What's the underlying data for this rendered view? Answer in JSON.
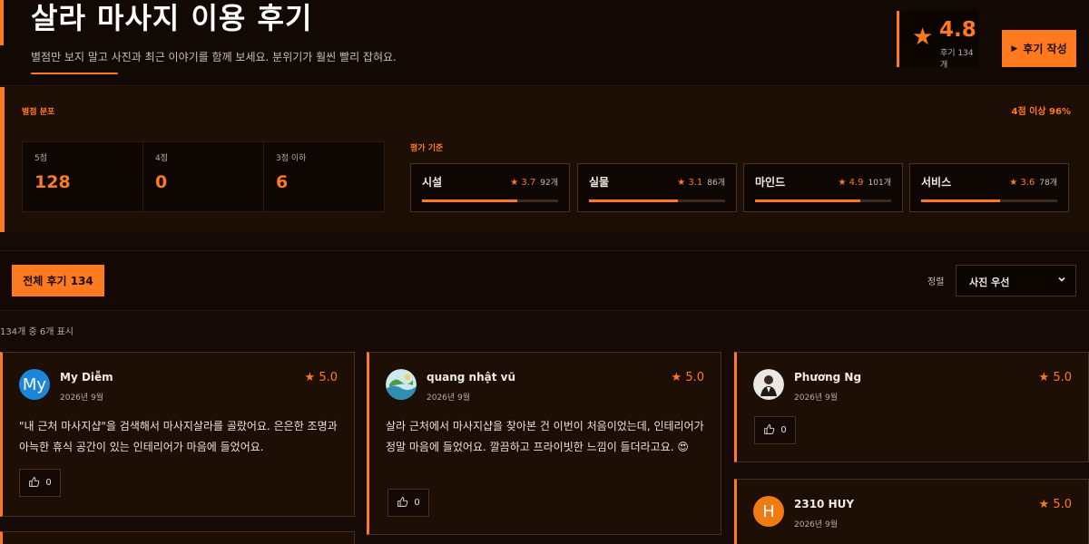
{
  "header": {
    "title": "살라 마사지 이용 후기",
    "subtitle": "별점만 보지 말고 사진과 최근 이야기를 함께 보세요. 분위기가 훨씬 빨리 잡혀요.",
    "rating": "4.8",
    "rating_count": "후기 134개",
    "write_button": "후기 작성"
  },
  "distribution": {
    "label": "별점 분포",
    "high_share": "4점 이상 96%",
    "scores": [
      {
        "label": "5점",
        "value": "128"
      },
      {
        "label": "4점",
        "value": "0"
      },
      {
        "label": "3점 이하",
        "value": "6"
      }
    ],
    "criteria_label": "평가 기준",
    "criteria": [
      {
        "name": "시설",
        "score": "3.7",
        "count": "92개",
        "fill": 0.7
      },
      {
        "name": "실물",
        "score": "3.1",
        "count": "86개",
        "fill": 0.65
      },
      {
        "name": "마인드",
        "score": "4.9",
        "count": "101개",
        "fill": 0.77
      },
      {
        "name": "서비스",
        "score": "3.6",
        "count": "78개",
        "fill": 0.58
      }
    ]
  },
  "filters": {
    "tab_all": "전체 후기 134",
    "sort_label": "정렬",
    "sort_value": "사진 우선"
  },
  "list_count": "134개 중 6개 표시",
  "reviews": [
    {
      "name": "My Diễm",
      "date": "2026년 9월",
      "score": "5.0",
      "avatar_letter": "My",
      "avatar_color": "#1e86d8",
      "text": "\"내 근처 마사지샵\"을 검색해서 마사지살라를 골랐어요. 은은한 조명과 아늑한 휴식 공간이 있는 인테리어가 마음에 들었어요.",
      "likes": "0"
    },
    {
      "name": "quang nhật vũ",
      "date": "2026년 9월",
      "score": "5.0",
      "text": "살라 근처에서 마사지샵을 찾아본 건 이번이 처음이었는데, 인테리어가 정말 마음에 들었어요. 깔끔하고 프라이빗한 느낌이 들더라고요. 😍",
      "likes": "0"
    },
    {
      "name": "Phương Ng",
      "date": "2026년 9월",
      "score": "5.0",
      "text": "",
      "likes": "0"
    },
    {
      "name": "2310 HUY",
      "date": "2026년 9월",
      "score": "5.0",
      "avatar_letter": "H",
      "avatar_color": "#f07b12",
      "text": "",
      "likes": ""
    }
  ]
}
